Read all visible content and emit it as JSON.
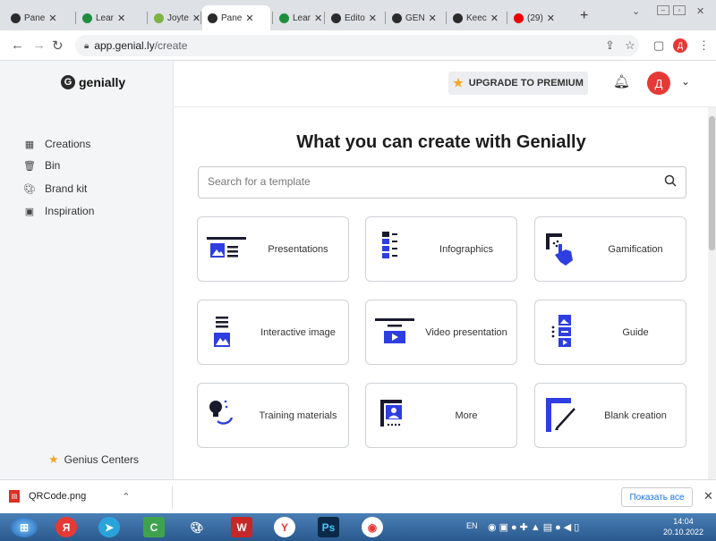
{
  "browser": {
    "tabs": [
      {
        "label": "Pane",
        "icon": "genially-icon",
        "color": "#2b2b2b"
      },
      {
        "label": "Lear",
        "icon": "learn-icon",
        "color": "#1e8e3e"
      },
      {
        "label": "Joyte",
        "icon": "joyteka-icon",
        "color": "#7cb342"
      },
      {
        "label": "Pane",
        "icon": "genially-icon",
        "color": "#2b2b2b"
      },
      {
        "label": "Lear",
        "icon": "learn-icon",
        "color": "#1e8e3e"
      },
      {
        "label": "Edito",
        "icon": "genially-icon",
        "color": "#2b2b2b"
      },
      {
        "label": "GEN",
        "icon": "genially-icon",
        "color": "#2b2b2b"
      },
      {
        "label": "Keec",
        "icon": "genially-icon",
        "color": "#2b2b2b"
      },
      {
        "label": "(29)",
        "icon": "youtube-icon",
        "color": "#e00"
      }
    ],
    "url": "app.genial.ly/create",
    "url_host": "app.genial.ly",
    "url_path": "/create"
  },
  "app": {
    "logo_text": "genially",
    "nav": [
      {
        "label": "Creations",
        "icon": "creations-icon"
      },
      {
        "label": "Bin",
        "icon": "bin-icon"
      },
      {
        "label": "Brand kit",
        "icon": "brand-kit-icon"
      },
      {
        "label": "Inspiration",
        "icon": "inspiration-icon"
      }
    ],
    "genius_centers": "Genius Centers",
    "upgrade_label": "UPGRADE TO PREMIUM",
    "avatar_letter": "Д"
  },
  "main": {
    "title": "What you can create with Genially",
    "search_placeholder": "Search for a template",
    "cards": [
      {
        "label": "Presentations"
      },
      {
        "label": "Infographics"
      },
      {
        "label": "Gamification"
      },
      {
        "label": "Interactive image"
      },
      {
        "label": "Video presentation"
      },
      {
        "label": "Guide"
      },
      {
        "label": "Training materials"
      },
      {
        "label": "More"
      },
      {
        "label": "Blank creation"
      }
    ]
  },
  "download_bar": {
    "file_name": "QRCode.png",
    "show_all": "Показать все"
  },
  "taskbar": {
    "lang": "EN",
    "time": "14:04",
    "date": "20.10.2022"
  },
  "colors": {
    "accent_blue": "#2f3ee0",
    "star": "#f5a623",
    "avatar": "#e53935"
  }
}
